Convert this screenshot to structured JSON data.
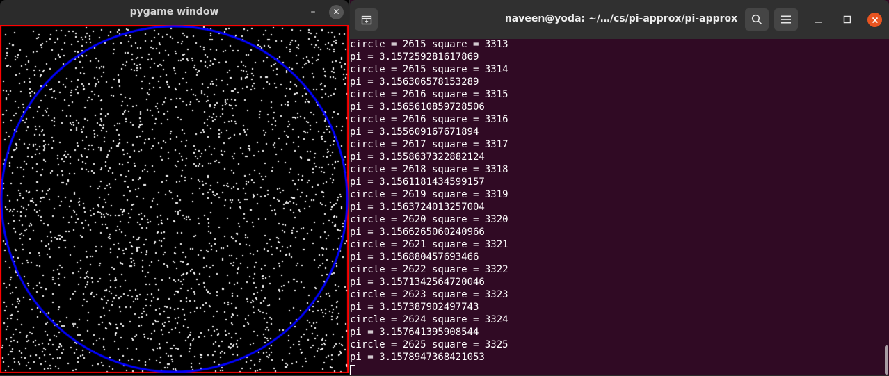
{
  "pygame_window": {
    "title": "pygame window",
    "minimize_label": "–",
    "close_label": "✕",
    "colors": {
      "background": "#000000",
      "square_border": "#ff0000",
      "circle": "#0000ff",
      "points": "#ffffff"
    }
  },
  "terminal": {
    "title": "naveen@yoda: ~/…/cs/pi-approx/pi-approx",
    "lines": [
      "circle = 2615 square = 3313",
      "pi = 3.157259281617869",
      "circle = 2615 square = 3314",
      "pi = 3.156306578153289",
      "circle = 2616 square = 3315",
      "pi = 3.1565610859728506",
      "circle = 2616 square = 3316",
      "pi = 3.155609167671894",
      "circle = 2617 square = 3317",
      "pi = 3.1558637322882124",
      "circle = 2618 square = 3318",
      "pi = 3.1561181434599157",
      "circle = 2619 square = 3319",
      "pi = 3.1563724013257004",
      "circle = 2620 square = 3320",
      "pi = 3.1566265060240966",
      "circle = 2621 square = 3321",
      "pi = 3.156880457693466",
      "circle = 2622 square = 3322",
      "pi = 3.1571342564720046",
      "circle = 2623 square = 3323",
      "pi = 3.157387902497743",
      "circle = 2624 square = 3324",
      "pi = 3.157641395908544",
      "circle = 2625 square = 3325",
      "pi = 3.1578947368421053"
    ],
    "colors": {
      "background": "#300a24",
      "headerbar": "#303030",
      "text": "#ffffff",
      "close_button": "#e95420"
    },
    "icons": {
      "new_tab": "new-tab-icon",
      "search": "search-icon",
      "menu": "hamburger-menu-icon",
      "minimize": "minimize-icon",
      "maximize": "maximize-icon",
      "close": "close-icon"
    }
  }
}
